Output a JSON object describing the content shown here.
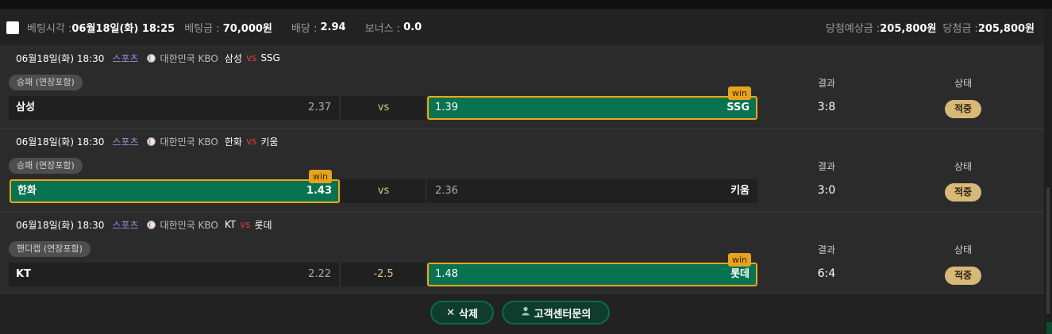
{
  "header": {
    "bet_time_label": "베팅시각 :",
    "bet_time_value": "06월18일(화) 18:25",
    "stake_label": "베팅금 :",
    "stake_value": "70,000원",
    "odds_label": "배당 :",
    "odds_value": "2.94",
    "bonus_label": "보너스 :",
    "bonus_value": "0.0",
    "expected_label": "당첨예상금 :",
    "expected_value": "205,800원",
    "won_label": "당첨금 :",
    "won_value": "205,800원"
  },
  "columns": {
    "result": "결과",
    "status": "상태"
  },
  "win_label": "win",
  "matches": [
    {
      "datetime": "06월18일(화) 18:30",
      "category": "스포츠",
      "league": "대한민국 KBO",
      "home": "삼성",
      "vs": "vs",
      "away": "SSG",
      "market": "승패 (연장포함)",
      "home_odds": "2.37",
      "middle": "vs",
      "away_odds": "1.39",
      "pick": "away",
      "score": "3:8",
      "status": "적중"
    },
    {
      "datetime": "06월18일(화) 18:30",
      "category": "스포츠",
      "league": "대한민국 KBO",
      "home": "한화",
      "vs": "vs",
      "away": "키움",
      "market": "승패 (연장포함)",
      "home_odds": "1.43",
      "middle": "vs",
      "away_odds": "2.36",
      "pick": "home",
      "score": "3:0",
      "status": "적중"
    },
    {
      "datetime": "06월18일(화) 18:30",
      "category": "스포츠",
      "league": "대한민국 KBO",
      "home": "KT",
      "vs": "vs",
      "away": "롯데",
      "market": "핸디캡 (연장포함)",
      "home_odds": "2.22",
      "middle": "-2.5",
      "away_odds": "1.48",
      "pick": "away",
      "score": "6:4",
      "status": "적중"
    }
  ],
  "footer": {
    "delete_label": "삭제",
    "delete_icon": "close-icon",
    "support_label": "고객센터문의",
    "support_icon": "user-icon"
  },
  "colors": {
    "win_fill": "#087350",
    "win_border": "#f0a51c",
    "status_badge": "#d8b878"
  }
}
